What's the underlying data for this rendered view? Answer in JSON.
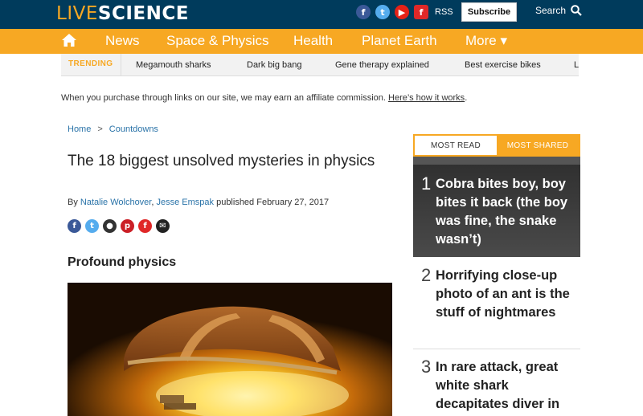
{
  "header": {
    "logo_live": "LIVE",
    "logo_science": "SCIENCE",
    "social_icons": [
      "facebook-icon",
      "twitter-icon",
      "youtube-icon",
      "flipboard-icon"
    ],
    "rss_label": "RSS",
    "subscribe_label": "Subscribe",
    "search_label": "Search"
  },
  "nav": {
    "home_icon": "home-icon",
    "items": [
      "News",
      "Space & Physics",
      "Health",
      "Planet Earth",
      "More ▾"
    ]
  },
  "trending": {
    "label": "TRENDING",
    "items": [
      "Megamouth sharks",
      "Dark big bang",
      "Gene therapy explained",
      "Best exercise bikes",
      "L"
    ]
  },
  "affiliate": {
    "text": "When you purchase through links on our site, we may earn an affiliate commission.",
    "link": "Here’s how it works",
    "end": "."
  },
  "breadcrumb": {
    "home": "Home",
    "separator": ">",
    "section": "Countdowns"
  },
  "article": {
    "title": "The 18 biggest unsolved mysteries in physics",
    "by": "By",
    "author1": "Natalie Wolchover",
    "comma": ",",
    "author2": "Jesse Emspak",
    "published": "published February 27, 2017",
    "share_icons": [
      "facebook-icon",
      "twitter-icon",
      "reddit-icon",
      "pinterest-icon",
      "flipboard-icon",
      "email-icon"
    ],
    "section_heading": "Profound physics"
  },
  "sidebar": {
    "tab_most_read": "MOST READ",
    "tab_most_shared": "MOST SHARED",
    "items": [
      {
        "rank": "1",
        "headline": "Cobra bites boy, boy bites it back (the boy was fine, the snake wasn’t)"
      },
      {
        "rank": "2",
        "headline": "Horrifying close-up photo of an ant is the stuff of nightmares"
      },
      {
        "rank": "3",
        "headline": "In rare attack, great white shark decapitates diver in"
      }
    ]
  },
  "colors": {
    "topbar": "#003b5c",
    "accent": "#f7a823",
    "link": "#2a73a8"
  }
}
